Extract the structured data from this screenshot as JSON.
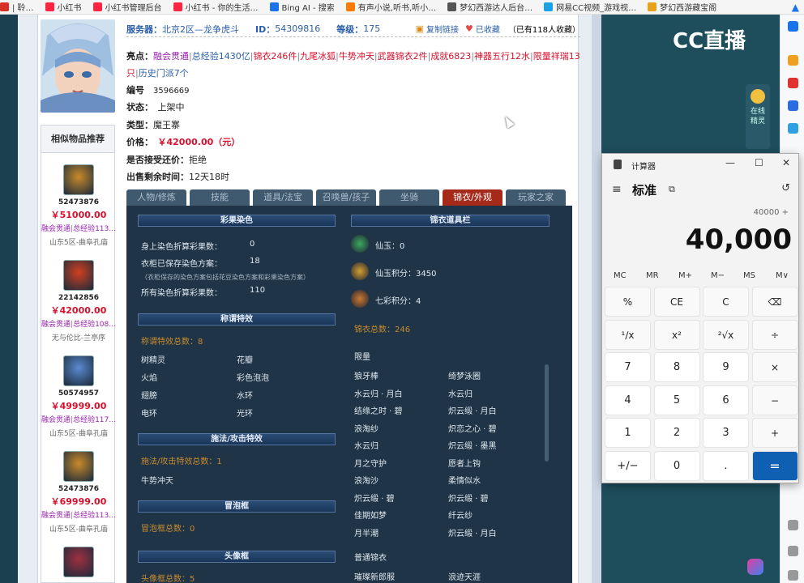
{
  "bookmarks": [
    {
      "label": "| 聆…",
      "color": "#d93025"
    },
    {
      "label": "小红书",
      "color": "#ff2442"
    },
    {
      "label": "小红书管理后台",
      "color": "#ff2442"
    },
    {
      "label": "小红书 - 你的生活…",
      "color": "#ff2442"
    },
    {
      "label": "Bing AI - 搜索",
      "color": "#1a73e8"
    },
    {
      "label": "有声小说,听书,听小…",
      "color": "#ff7a00"
    },
    {
      "label": "梦幻西游达人后台…",
      "color": "#555555"
    },
    {
      "label": "网易CC视频_游戏视…",
      "color": "#1aa1e8"
    },
    {
      "label": "梦幻西游藏宝阁",
      "color": "#e7a11a"
    }
  ],
  "listing": {
    "server_label": "服务器：",
    "server": "北京2区—龙争虎斗",
    "id_label": "ID：",
    "id": "54309816",
    "level_label": "等级：",
    "level": "175",
    "copy_link": "复制链接",
    "favorited": "已收藏",
    "fav_count": "（已有118人收藏）",
    "highlights_label": "亮点：",
    "highlights": [
      "融会贯通",
      "总经验1430亿",
      "锦衣246件",
      "九尾冰狐",
      "牛势冲天",
      "武器锦衣2件",
      "成就6823",
      "神器五行12水",
      "限量祥瑞13只",
      "历史门派7个"
    ],
    "number_label": "编号",
    "number": "3596669",
    "status_label": "状态：",
    "status": "上架中",
    "type_label": "类型：",
    "type": "魔王寨",
    "price_label": "价格：",
    "price": "￥42000.00（元）",
    "bargain_label": "是否接受还价：",
    "bargain": "拒绝",
    "time_label": "出售剩余时间：",
    "time": "12天18时"
  },
  "similar": {
    "title": "相似物品推荐",
    "items": [
      {
        "id": "52473876",
        "price": "￥51000.00",
        "t1": "融会贯通",
        "t2": "总经验113…",
        "server": "山东5区-曲阜孔庙",
        "color": "#c98a2a"
      },
      {
        "id": "22142856",
        "price": "￥42000.00",
        "t1": "融会贯通",
        "t2": "总经验108…",
        "server": "无与伦比-兰亭序",
        "color": "#d04020"
      },
      {
        "id": "50574957",
        "price": "￥49999.00",
        "t1": "融会贯通",
        "t2": "总经验117…",
        "server": "山东5区-曲阜孔庙",
        "color": "#5a8ad0"
      },
      {
        "id": "52473876",
        "price": "￥69999.00",
        "t1": "融会贯通",
        "t2": "总经验113…",
        "server": "山东5区-曲阜孔庙",
        "color": "#c98a2a"
      },
      {
        "id": "",
        "price": "",
        "t1": "",
        "t2": "",
        "server": "",
        "color": "#a03040"
      }
    ]
  },
  "tabs": [
    "人物/修炼",
    "技能",
    "道具/法宝",
    "召唤兽/孩子",
    "坐骑",
    "锦衣/外观",
    "玩家之家"
  ],
  "panel": {
    "dye_title": "彩果染色",
    "dye_rows": [
      {
        "label": "身上染色折算彩果数：",
        "value": "0"
      },
      {
        "label": "衣柜已保存染色方案：",
        "value": "18"
      },
      {
        "label": "所有染色折算彩果数：",
        "value": "110"
      }
    ],
    "dye_note": "（衣柜保存的染色方案包括花豆染色方案和彩果染色方案）",
    "title_title": "称谓特效",
    "title_count": "称谓特效总数：8",
    "title_items": [
      "树精灵",
      "花瓣",
      "火焰",
      "彩色泡泡",
      "翅膀",
      "水环",
      "电环",
      "光环"
    ],
    "spell_title": "施法/攻击特效",
    "spell_count": "施法/攻击特效总数：1",
    "spell_items": [
      "牛势冲天"
    ],
    "bubble_title": "冒泡框",
    "bubble_count": "冒泡框总数：0",
    "avatar_title": "头像框",
    "avatar_count": "头像框总数：5",
    "jinyi_title": "锦衣道具栏",
    "currency": [
      {
        "label": "仙玉：0",
        "color": "#3aa860"
      },
      {
        "label": "仙玉积分：3450",
        "color": "#d0a030"
      },
      {
        "label": "七彩积分：4",
        "color": "#c87a30"
      }
    ],
    "jinyi_count": "锦衣总数：246",
    "limited_label": "限量",
    "limited_items": [
      "狼牙棒",
      "绮梦泳圈",
      "水云归 · 月白",
      "水云归",
      "结缘之时 · 碧",
      "炽云缎 · 月白",
      "浪淘纱",
      "炽恋之心 · 碧",
      "水云归",
      "炽云缎 · 墨黑",
      "月之守护",
      "愿者上钩",
      "浪淘沙",
      "柔情似水",
      "炽云缎 · 碧",
      "炽云缎 · 碧",
      "佳期如梦",
      "纤云纱",
      "月半潮",
      "炽云缎 · 月白"
    ],
    "normal_label": "普通锦衣",
    "normal_items": [
      "璀璨新郎服",
      "浪迹天涯"
    ]
  },
  "calculator": {
    "title": "计算器",
    "mode": "标准",
    "expression": "40000 +",
    "result": "40,000",
    "memory": [
      "MC",
      "MR",
      "M+",
      "M−",
      "MS",
      "M∨"
    ],
    "keys": [
      "%",
      "CE",
      "C",
      "⌫",
      "¹∕x",
      "x²",
      "²√x",
      "÷",
      "7",
      "8",
      "9",
      "×",
      "4",
      "5",
      "6",
      "−",
      "1",
      "2",
      "3",
      "+",
      "+∕−",
      "0",
      ".",
      "="
    ]
  },
  "stream": {
    "logo": "CC直播",
    "side_text": "在线精灵"
  }
}
